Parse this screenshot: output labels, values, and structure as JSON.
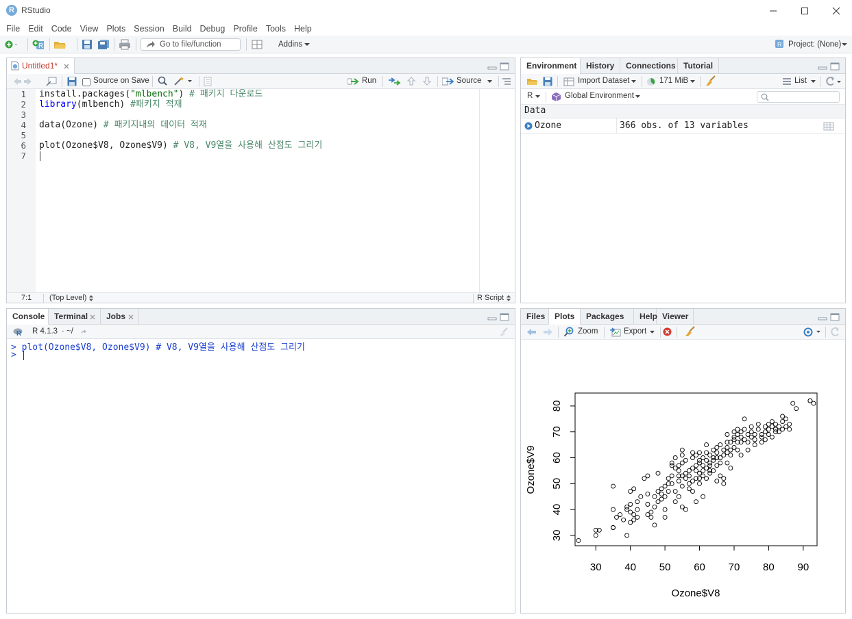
{
  "window": {
    "title": "RStudio",
    "logo_letter": "R"
  },
  "menubar": [
    "File",
    "Edit",
    "Code",
    "View",
    "Plots",
    "Session",
    "Build",
    "Debug",
    "Profile",
    "Tools",
    "Help"
  ],
  "toolbar": {
    "goto_placeholder": "Go to file/function",
    "addins": "Addins",
    "project": "Project: (None)"
  },
  "editor": {
    "tab_label": "Untitled1*",
    "source_on_save": "Source on Save",
    "run": "Run",
    "source": "Source",
    "line_numbers": [
      "1",
      "2",
      "3",
      "4",
      "5",
      "6",
      "7"
    ],
    "lines": [
      [
        "install.packages(",
        "\"mlbench\"",
        ") ",
        "# 패키지 다운로드"
      ],
      [
        "library",
        "(mlbench) ",
        "#패키지 적재"
      ],
      [
        ""
      ],
      [
        "data(Ozone) ",
        "# 패키지내의 데이터 적재"
      ],
      [
        ""
      ],
      [
        "plot(Ozone$V8, Ozone$V9) ",
        "# V8, V9열을 사용해 산점도 그리기"
      ],
      [
        ""
      ]
    ],
    "status_pos": "7:1",
    "status_scope": "(Top Level)",
    "status_type": "R Script"
  },
  "console": {
    "tabs": [
      "Console",
      "Terminal",
      "Jobs"
    ],
    "version": "R 4.1.3",
    "path": "· ~/",
    "history_line": "> plot(Ozone$V8, Ozone$V9) # V8, V9열을 사용해 산점도 그리기",
    "prompt": ">"
  },
  "environment": {
    "tabs": [
      "Environment",
      "History",
      "Connections",
      "Tutorial"
    ],
    "import_dataset": "Import Dataset",
    "memory": "171 MiB",
    "list_mode": "List",
    "lang": "R",
    "scope": "Global Environment",
    "section": "Data",
    "rows": [
      {
        "name": "Ozone",
        "value": "366 obs. of 13 variables"
      }
    ]
  },
  "files_pane": {
    "tabs": [
      "Files",
      "Plots",
      "Packages",
      "Help",
      "Viewer"
    ],
    "zoom": "Zoom",
    "export": "Export"
  },
  "chart_data": {
    "type": "scatter",
    "xlabel": "Ozone$V8",
    "ylabel": "Ozone$V9",
    "xlim": [
      24,
      94
    ],
    "ylim": [
      26,
      85
    ],
    "xticks": [
      30,
      40,
      50,
      60,
      70,
      80,
      90
    ],
    "yticks": [
      30,
      40,
      50,
      60,
      70,
      80
    ],
    "points": [
      [
        25,
        28
      ],
      [
        30,
        30
      ],
      [
        30,
        32
      ],
      [
        31,
        32
      ],
      [
        35,
        33
      ],
      [
        35,
        33
      ],
      [
        35,
        40
      ],
      [
        35,
        49
      ],
      [
        36,
        37
      ],
      [
        37,
        38
      ],
      [
        38,
        36
      ],
      [
        39,
        40
      ],
      [
        39,
        41
      ],
      [
        39,
        30
      ],
      [
        40,
        39
      ],
      [
        40,
        42
      ],
      [
        40,
        35
      ],
      [
        40,
        47
      ],
      [
        41,
        48
      ],
      [
        41,
        36
      ],
      [
        41,
        38
      ],
      [
        42,
        37
      ],
      [
        42,
        40
      ],
      [
        42,
        43
      ],
      [
        43,
        45
      ],
      [
        44,
        52
      ],
      [
        45,
        53
      ],
      [
        45,
        46
      ],
      [
        45,
        42
      ],
      [
        45,
        38
      ],
      [
        46,
        39
      ],
      [
        46,
        37
      ],
      [
        47,
        34
      ],
      [
        47,
        41
      ],
      [
        47,
        45
      ],
      [
        48,
        43
      ],
      [
        48,
        47
      ],
      [
        48,
        54
      ],
      [
        49,
        46
      ],
      [
        49,
        44
      ],
      [
        49,
        48
      ],
      [
        50,
        45
      ],
      [
        50,
        49
      ],
      [
        50,
        40
      ],
      [
        50,
        37
      ],
      [
        51,
        47
      ],
      [
        51,
        50
      ],
      [
        51,
        52
      ],
      [
        52,
        50
      ],
      [
        52,
        53
      ],
      [
        52,
        57
      ],
      [
        52,
        58
      ],
      [
        53,
        47
      ],
      [
        53,
        43
      ],
      [
        53,
        56
      ],
      [
        53,
        60
      ],
      [
        54,
        51
      ],
      [
        54,
        53
      ],
      [
        54,
        55
      ],
      [
        54,
        45
      ],
      [
        54,
        57
      ],
      [
        55,
        49
      ],
      [
        55,
        58
      ],
      [
        55,
        61
      ],
      [
        55,
        63
      ],
      [
        55,
        53
      ],
      [
        55,
        41
      ],
      [
        56,
        54
      ],
      [
        56,
        52
      ],
      [
        56,
        40
      ],
      [
        56,
        59
      ],
      [
        57,
        53
      ],
      [
        57,
        50
      ],
      [
        57,
        48
      ],
      [
        57,
        55
      ],
      [
        58,
        51
      ],
      [
        58,
        56
      ],
      [
        58,
        60
      ],
      [
        58,
        62
      ],
      [
        58,
        47
      ],
      [
        59,
        52
      ],
      [
        59,
        57
      ],
      [
        59,
        55
      ],
      [
        59,
        43
      ],
      [
        59,
        61
      ],
      [
        60,
        52
      ],
      [
        60,
        54
      ],
      [
        60,
        58
      ],
      [
        60,
        62
      ],
      [
        60,
        50
      ],
      [
        60,
        59
      ],
      [
        61,
        53
      ],
      [
        61,
        55
      ],
      [
        61,
        57
      ],
      [
        61,
        60
      ],
      [
        61,
        45
      ],
      [
        62,
        52
      ],
      [
        62,
        56
      ],
      [
        62,
        59
      ],
      [
        62,
        62
      ],
      [
        62,
        65
      ],
      [
        63,
        54
      ],
      [
        63,
        57
      ],
      [
        63,
        58
      ],
      [
        63,
        61
      ],
      [
        63,
        55
      ],
      [
        64,
        55
      ],
      [
        64,
        59
      ],
      [
        64,
        63
      ],
      [
        64,
        60
      ],
      [
        65,
        57
      ],
      [
        65,
        60
      ],
      [
        65,
        62
      ],
      [
        65,
        64
      ],
      [
        65,
        51
      ],
      [
        66,
        60
      ],
      [
        66,
        58
      ],
      [
        66,
        65
      ],
      [
        66,
        53
      ],
      [
        67,
        61
      ],
      [
        67,
        63
      ],
      [
        67,
        52
      ],
      [
        67,
        50
      ],
      [
        68,
        62
      ],
      [
        68,
        64
      ],
      [
        68,
        66
      ],
      [
        68,
        58
      ],
      [
        68,
        69
      ],
      [
        69,
        63
      ],
      [
        69,
        66
      ],
      [
        69,
        61
      ],
      [
        69,
        56
      ],
      [
        70,
        64
      ],
      [
        70,
        67
      ],
      [
        70,
        70
      ],
      [
        70,
        68
      ],
      [
        71,
        66
      ],
      [
        71,
        69
      ],
      [
        71,
        63
      ],
      [
        71,
        71
      ],
      [
        72,
        66
      ],
      [
        72,
        68
      ],
      [
        72,
        70
      ],
      [
        72,
        61
      ],
      [
        73,
        67
      ],
      [
        73,
        75
      ],
      [
        73,
        71
      ],
      [
        74,
        66
      ],
      [
        74,
        69
      ],
      [
        74,
        63
      ],
      [
        75,
        70
      ],
      [
        75,
        72
      ],
      [
        75,
        68
      ],
      [
        76,
        69
      ],
      [
        76,
        67
      ],
      [
        76,
        65
      ],
      [
        77,
        71
      ],
      [
        77,
        73
      ],
      [
        78,
        69
      ],
      [
        78,
        68
      ],
      [
        78,
        66
      ],
      [
        79,
        70
      ],
      [
        79,
        72
      ],
      [
        79,
        67
      ],
      [
        80,
        71
      ],
      [
        80,
        73
      ],
      [
        80,
        69
      ],
      [
        81,
        72
      ],
      [
        81,
        74
      ],
      [
        81,
        68
      ],
      [
        82,
        70
      ],
      [
        82,
        73
      ],
      [
        82,
        71
      ],
      [
        83,
        72
      ],
      [
        83,
        70
      ],
      [
        84,
        74
      ],
      [
        84,
        76
      ],
      [
        84,
        71
      ],
      [
        85,
        72
      ],
      [
        85,
        75
      ],
      [
        86,
        73
      ],
      [
        86,
        71
      ],
      [
        87,
        81
      ],
      [
        88,
        79
      ],
      [
        92,
        82
      ],
      [
        92,
        82
      ],
      [
        93,
        81
      ]
    ]
  }
}
